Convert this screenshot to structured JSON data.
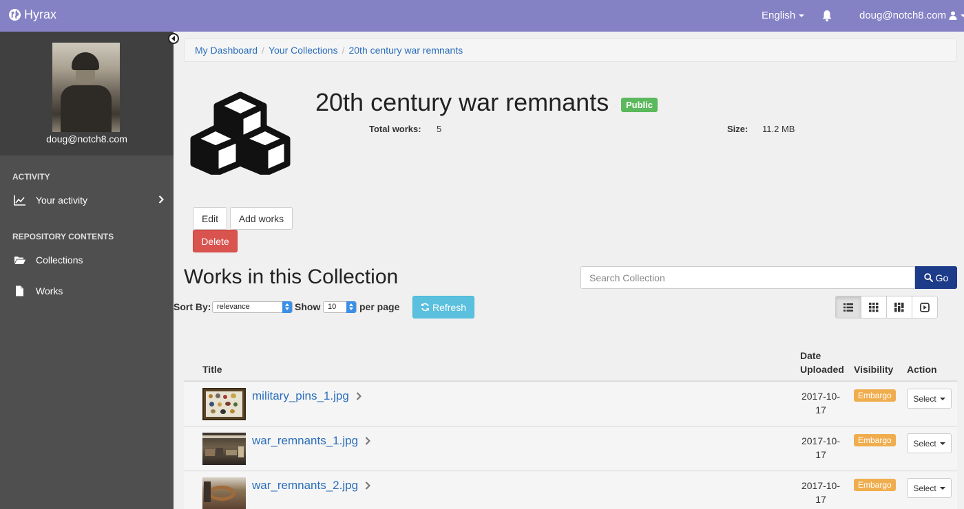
{
  "nav": {
    "brand": "Hyrax",
    "language": "English",
    "user": "doug@notch8.com"
  },
  "sidebar": {
    "profile_name": "doug@notch8.com",
    "activity_heading": "ACTIVITY",
    "your_activity": "Your activity",
    "repo_heading": "REPOSITORY CONTENTS",
    "collections": "Collections",
    "works": "Works"
  },
  "breadcrumb": [
    "My Dashboard",
    "Your Collections",
    "20th century war remnants"
  ],
  "collection": {
    "title": "20th century war remnants",
    "visibility": "Public",
    "total_works_label": "Total works:",
    "total_works": "5",
    "size_label": "Size:",
    "size": "11.2 MB"
  },
  "actions": {
    "edit": "Edit",
    "add_works": "Add works",
    "delete": "Delete"
  },
  "works_section": {
    "title": "Works in this Collection",
    "search_placeholder": "Search Collection",
    "go": "Go",
    "sort_by_label": "Sort By:",
    "sort_value": "relevance",
    "show_label": "Show",
    "per_page_value": "10",
    "per_page_label": "per page",
    "refresh": "Refresh"
  },
  "table": {
    "col_title": "Title",
    "col_date_1": "Date",
    "col_date_2": "Uploaded",
    "col_visibility": "Visibility",
    "col_action": "Action",
    "rows": [
      {
        "title": "military_pins_1.jpg",
        "date_1": "2017-10-",
        "date_2": "17",
        "visibility": "Embargo",
        "action": "Select"
      },
      {
        "title": "war_remnants_1.jpg",
        "date_1": "2017-10-",
        "date_2": "17",
        "visibility": "Embargo",
        "action": "Select"
      },
      {
        "title": "war_remnants_2.jpg",
        "date_1": "2017-10-",
        "date_2": "17",
        "visibility": "Embargo",
        "action": "Select"
      }
    ]
  },
  "colors": {
    "navbar": "#8481c5",
    "sidebar": "#4f4f4f",
    "link": "#2a6ebb",
    "public_badge": "#5cb85c",
    "embargo_badge": "#f0ad4e",
    "delete": "#d9534f",
    "go_button": "#1c3b89",
    "refresh_button": "#5bc0de"
  },
  "icons": [
    "globe-icon",
    "bell-icon",
    "user-icon",
    "line-chart-icon",
    "folder-open-icon",
    "file-icon",
    "cubes-icon",
    "search-icon",
    "refresh-icon",
    "list-view-icon",
    "grid-view-icon",
    "masonry-view-icon",
    "slideshow-view-icon",
    "chevron-right-icon"
  ]
}
